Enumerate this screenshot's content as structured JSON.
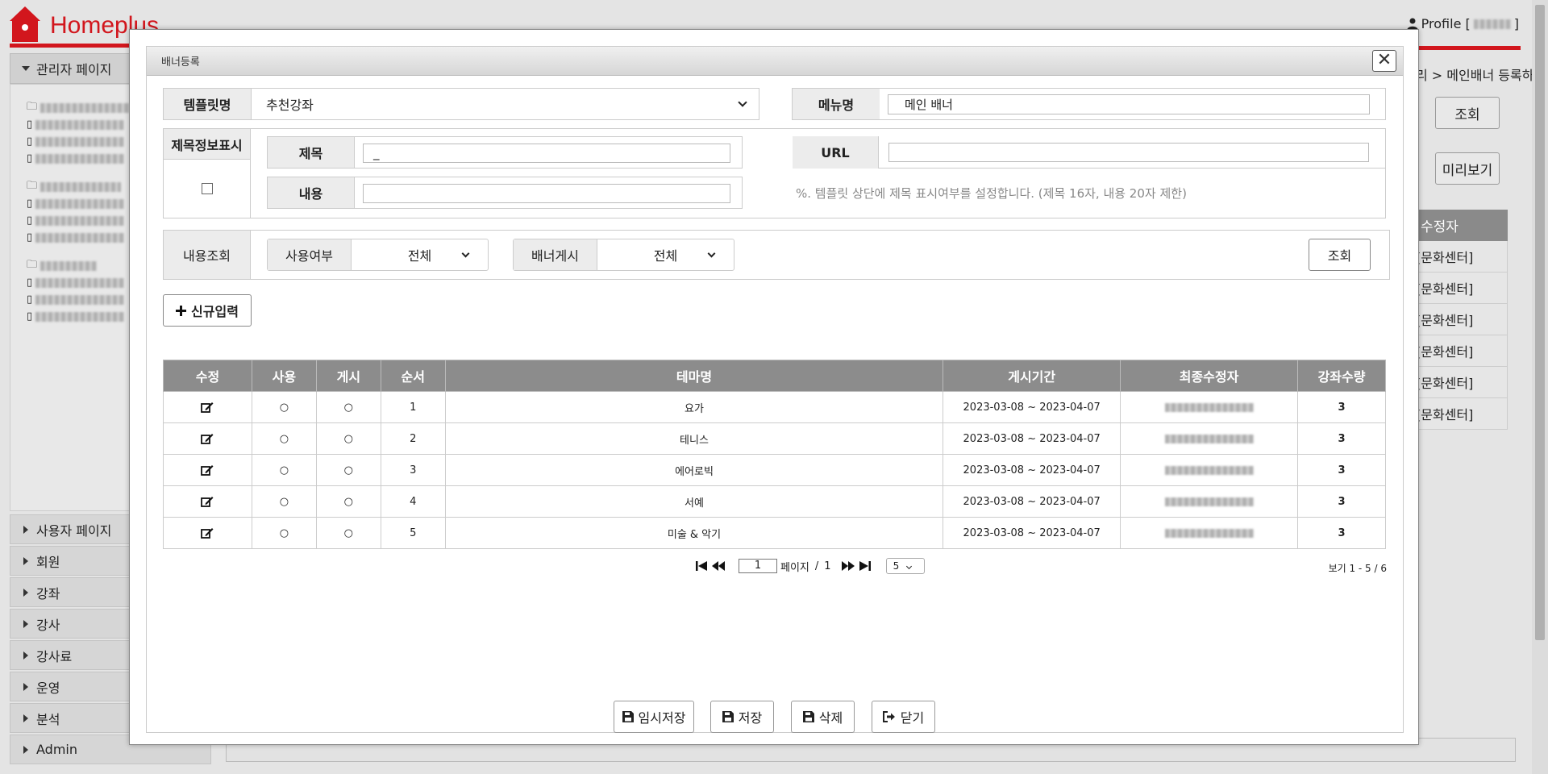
{
  "app": {
    "brand": "Homeplus",
    "profile_label": "Profile [",
    "profile_close": "]",
    "breadcrumb": "리 > 메인배너 등록하기"
  },
  "sidebar": {
    "admin_page": "관리자 페이지",
    "items": [
      {
        "label": "사용자 페이지"
      },
      {
        "label": "회원"
      },
      {
        "label": "강좌"
      },
      {
        "label": "강사"
      },
      {
        "label": "강사료"
      },
      {
        "label": "운영"
      },
      {
        "label": "분석"
      },
      {
        "label": "Admin"
      }
    ]
  },
  "background": {
    "search_button": "조회",
    "preview_button": "미리보기",
    "modifier_header": "수정자",
    "modifier_cells": [
      "[문화센터]",
      "[문화센터]",
      "[문화센터]",
      "[문화센터]",
      "[문화센터]",
      "[문화센터]"
    ]
  },
  "modal": {
    "title": "배너등록",
    "close": "✕",
    "template_label": "템플릿명",
    "template_value": "추천강좌",
    "menu_label": "메뉴명",
    "menu_value": "메인 배너",
    "title_display_label": "제목정보표시",
    "subject_label": "제목",
    "subject_value": "_",
    "url_label": "URL",
    "url_value": "",
    "content_label": "내용",
    "content_value": "",
    "note": "%. 템플릿 상단에 제목 표시여부를 설정합니다. (제목 16자, 내용 20자 제한)",
    "search_section_label": "내용조회",
    "use_label": "사용여부",
    "use_value": "전체",
    "post_label": "배너게시",
    "post_value": "전체",
    "search_button": "조회",
    "new_button": "신규입력",
    "new_icon": "plus-icon"
  },
  "table": {
    "headers": [
      "수정",
      "사용",
      "게시",
      "순서",
      "테마명",
      "게시기간",
      "최종수정자",
      "강좌수량"
    ],
    "rows": [
      {
        "use": "○",
        "post": "○",
        "order": "1",
        "theme": "요가",
        "period": "2023-03-08 ~ 2023-04-07",
        "count": "3"
      },
      {
        "use": "○",
        "post": "○",
        "order": "2",
        "theme": "테니스",
        "period": "2023-03-08 ~ 2023-04-07",
        "count": "3"
      },
      {
        "use": "○",
        "post": "○",
        "order": "3",
        "theme": "에어로빅",
        "period": "2023-03-08 ~ 2023-04-07",
        "count": "3"
      },
      {
        "use": "○",
        "post": "○",
        "order": "4",
        "theme": "서예",
        "period": "2023-03-08 ~ 2023-04-07",
        "count": "3"
      },
      {
        "use": "○",
        "post": "○",
        "order": "5",
        "theme": "미술 & 악기",
        "period": "2023-03-08 ~ 2023-04-07",
        "count": "3"
      }
    ]
  },
  "pager": {
    "page_value": "1",
    "page_label": "페이지",
    "slash": "/",
    "total_pages": "1",
    "page_size": "5",
    "view_text": "보기 1 - 5 / 6"
  },
  "footer": {
    "temp_save": "임시저장",
    "save": "저장",
    "delete": "삭제",
    "close": "닫기"
  },
  "colors": {
    "brand_red": "#d2161d",
    "table_header": "#8c8c8c"
  }
}
